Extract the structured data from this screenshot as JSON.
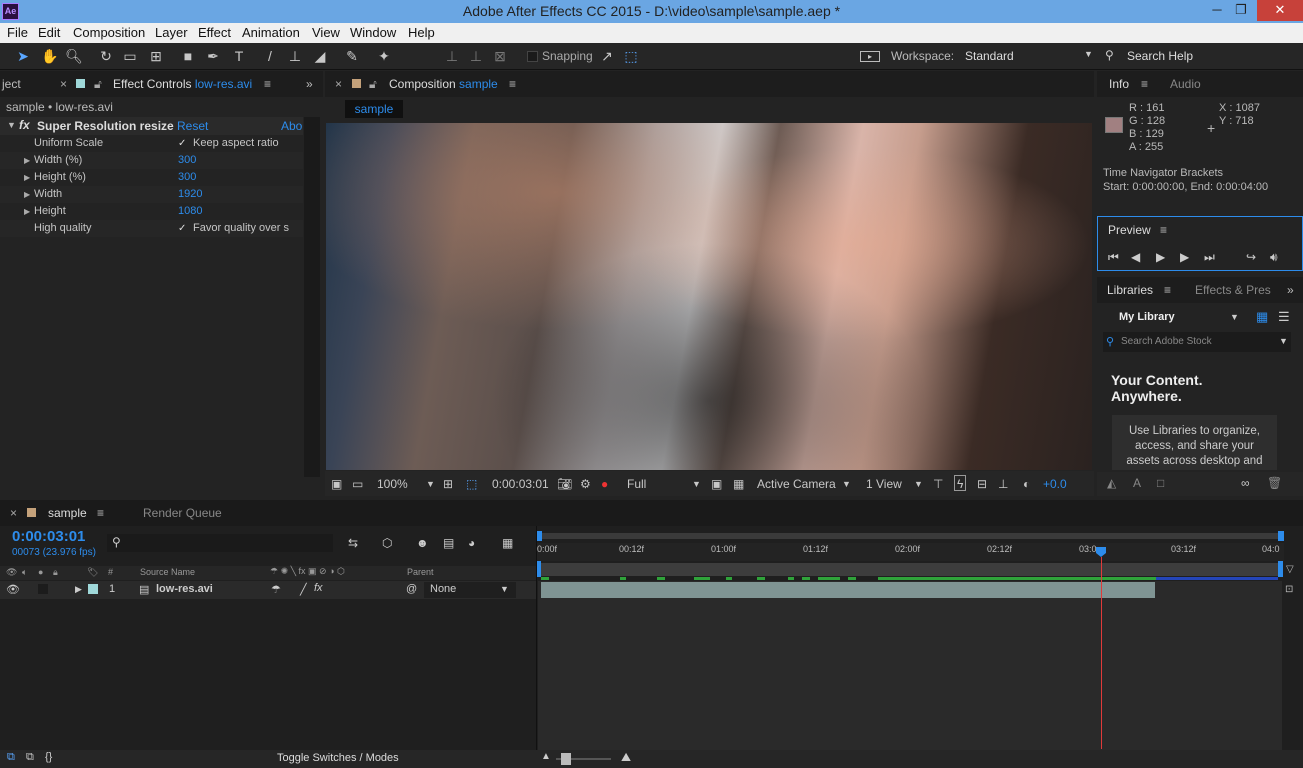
{
  "window": {
    "title": "Adobe After Effects CC 2015 - D:\\video\\sample\\sample.aep *",
    "app_badge": "Ae",
    "controls": {
      "minimize": "─",
      "restore": "❐",
      "close": "✕"
    }
  },
  "menu": [
    "File",
    "Edit",
    "Composition",
    "Layer",
    "Effect",
    "Animation",
    "View",
    "Window",
    "Help"
  ],
  "toolbar": {
    "snapping_label": "Snapping",
    "workspace_label": "Workspace:",
    "workspace_value": "Standard",
    "search_help": "Search Help"
  },
  "effect_controls": {
    "tab_partial": "ject",
    "tab_label": "Effect Controls",
    "tab_file": "low-res.avi",
    "breadcrumb": "sample • low-res.avi",
    "effect_name": "Super Resolution resize",
    "reset": "Reset",
    "about": "Abo",
    "rows": [
      {
        "label": "Uniform Scale",
        "value": "Keep aspect ratio",
        "type": "checkbox"
      },
      {
        "label": "Width (%)",
        "value": "300",
        "type": "number"
      },
      {
        "label": "Height (%)",
        "value": "300",
        "type": "number"
      },
      {
        "label": "Width",
        "value": "1920",
        "type": "number"
      },
      {
        "label": "Height",
        "value": "1080",
        "type": "number"
      },
      {
        "label": "High quality",
        "value": "Favor quality over s",
        "type": "checkbox"
      }
    ]
  },
  "composition": {
    "tab_label": "Composition",
    "tab_name": "sample",
    "sub_tab": "sample",
    "zoom": "100%",
    "timecode": "0:00:03:01",
    "resolution": "Full",
    "camera": "Active Camera",
    "views": "1 View",
    "exposure": "+0.0"
  },
  "info": {
    "tab": "Info",
    "tab2": "Audio",
    "r": "R : 161",
    "g": "G : 128",
    "b": "B : 129",
    "a": "A : 255",
    "x": "X : 1087",
    "y": "Y : 718",
    "swatch": "#a18081",
    "nav_title": "Time Navigator Brackets",
    "nav_range": "Start: 0:00:00:00, End: 0:00:04:00"
  },
  "preview": {
    "tab": "Preview"
  },
  "libraries": {
    "tab": "Libraries",
    "tab2": "Effects & Pres",
    "library": "My Library",
    "search_placeholder": "Search Adobe Stock",
    "headline1": "Your Content.",
    "headline2": "Anywhere.",
    "body": [
      "Use Libraries to organize,",
      "access, and share your",
      "assets across desktop and"
    ]
  },
  "timeline": {
    "tab": "sample",
    "tab2": "Render Queue",
    "timecode": "0:00:03:01",
    "frames": "00073 (23.976 fps)",
    "col_num": "#",
    "col_source": "Source Name",
    "col_parent": "Parent",
    "layer": {
      "num": "1",
      "name": "low-res.avi",
      "parent": "None"
    },
    "ticks": [
      "0:00f",
      "00:12f",
      "01:00f",
      "01:12f",
      "02:00f",
      "02:12f",
      "03:0",
      "03:12f",
      "04:0"
    ],
    "toggle": "Toggle Switches / Modes"
  }
}
